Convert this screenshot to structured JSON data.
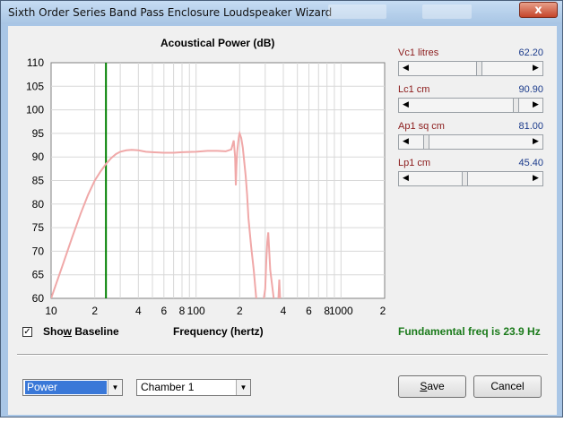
{
  "window": {
    "title": "Sixth Order Series Band Pass Enclosure Loudspeaker Wizard",
    "close_glyph": "x"
  },
  "chart": {
    "title": "Acoustical Power (dB)",
    "xlabel": "Frequency (hertz)"
  },
  "chart_data": {
    "type": "line",
    "title": "Acoustical Power (dB)",
    "xlabel": "Frequency (hertz)",
    "ylabel": "",
    "xscale": "log",
    "xlim": [
      10,
      2000
    ],
    "ylim": [
      60,
      110
    ],
    "yticks": [
      110,
      105,
      100,
      95,
      90,
      85,
      80,
      75,
      70,
      65,
      60
    ],
    "xtick_labels": [
      "10",
      "2",
      "4",
      "6",
      "8",
      "100",
      "2",
      "4",
      "6",
      "8",
      "1000",
      "2"
    ],
    "grid": true,
    "marker_line": {
      "x": 23.9,
      "color": "#008000"
    },
    "series": [
      {
        "color": "#f0a8a8",
        "x": [
          10,
          12,
          14,
          16,
          18,
          20,
          22,
          24,
          26,
          28,
          30,
          33,
          36,
          40,
          45,
          50,
          60,
          70,
          80,
          100,
          120,
          140,
          160,
          175,
          182,
          186,
          188,
          190,
          192,
          195,
          198,
          200,
          205,
          210,
          215,
          220,
          225,
          230,
          240,
          250,
          260,
          280,
          290,
          300,
          305,
          310,
          315,
          325,
          350,
          365,
          370,
          375,
          380,
          390,
          400
        ],
        "y": [
          60,
          67,
          73,
          78,
          82,
          85,
          87,
          88.6,
          89.8,
          90.6,
          91.1,
          91.4,
          91.5,
          91.4,
          91.1,
          91,
          90.9,
          90.9,
          91,
          91.1,
          91.3,
          91.3,
          91.2,
          91.6,
          93.5,
          90,
          84,
          88,
          91,
          93,
          94.5,
          95,
          94,
          92,
          89,
          86,
          82,
          77,
          71,
          66,
          60,
          58,
          59,
          62,
          68,
          72,
          74,
          66,
          58,
          58,
          60,
          64,
          60,
          58,
          58
        ]
      }
    ]
  },
  "sliders": [
    {
      "label": "Vc1  litres",
      "value": "62.20",
      "level": 0.58
    },
    {
      "label": "Lc1  cm",
      "value": "90.90",
      "level": 0.91
    },
    {
      "label": "Ap1  sq cm",
      "value": "81.00",
      "level": 0.1
    },
    {
      "label": "Lp1  cm",
      "value": "45.40",
      "level": 0.45
    }
  ],
  "baseline": {
    "label": "Show Baseline",
    "checked": true,
    "check_glyph": "✓"
  },
  "fundamental": "Fundamental freq is 23.9 Hz",
  "combos": {
    "mode": "Power",
    "chamber": "Chamber 1"
  },
  "buttons": {
    "save": "Save",
    "cancel": "Cancel"
  }
}
